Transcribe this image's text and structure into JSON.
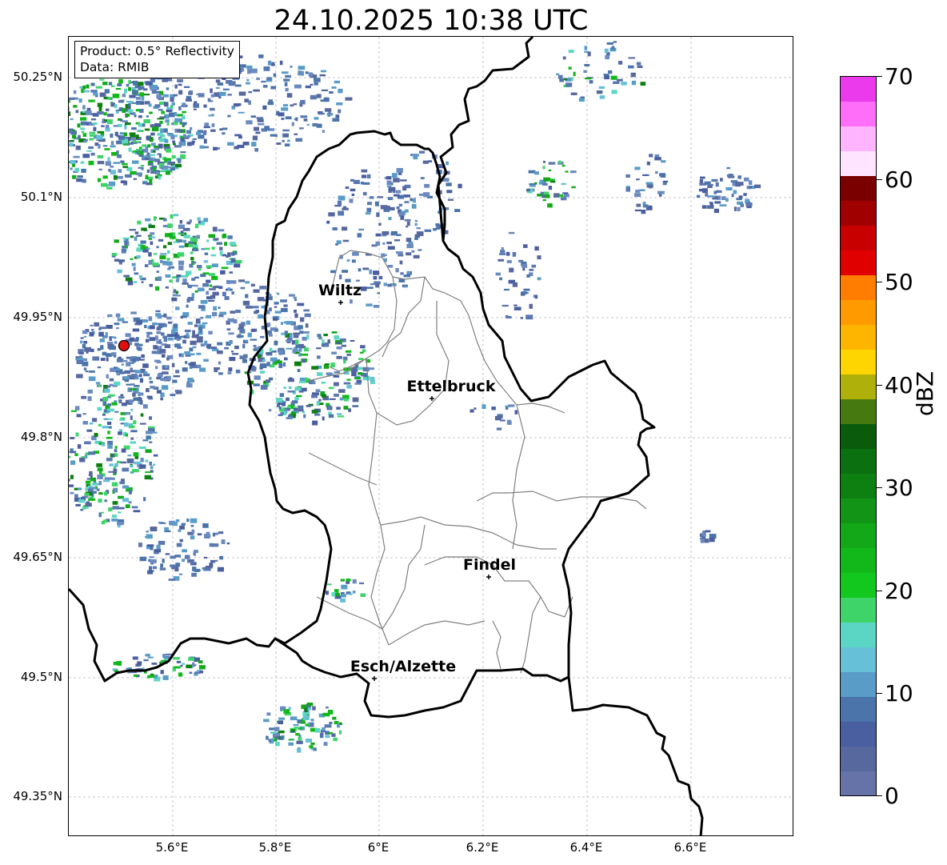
{
  "title": "24.10.2025 10:38 UTC",
  "info_box": {
    "product": "Product: 0.5° Reflectivity",
    "data": "Data: RMIB"
  },
  "axes": {
    "lat_labels": [
      "50.25°N",
      "50.1°N",
      "49.95°N",
      "49.8°N",
      "49.65°N",
      "49.5°N",
      "49.35°N"
    ],
    "lon_labels": [
      "5.6°E",
      "5.8°E",
      "6°E",
      "6.2°E",
      "6.4°E",
      "6.6°E"
    ],
    "gridlines": true
  },
  "cities": [
    {
      "name": "Wiltz"
    },
    {
      "name": "Ettelbruck"
    },
    {
      "name": "Findel"
    },
    {
      "name": "Esch/Alzette"
    }
  ],
  "radar_site": {
    "marker_color": "#e01010"
  },
  "colorbar": {
    "unit": "dBZ",
    "min": 0,
    "max": 70,
    "tick_labels": [
      "70",
      "60",
      "50",
      "40",
      "30",
      "20",
      "10",
      "0"
    ],
    "colors": [
      "#6673a8",
      "#56689e",
      "#4a5fa0",
      "#4a74aa",
      "#5a9cc8",
      "#66c0d8",
      "#5cd6c4",
      "#3fd46a",
      "#12c81e",
      "#12b81a",
      "#12a818",
      "#129416",
      "#0e8012",
      "#0a7010",
      "#0a5c0c",
      "#467a10",
      "#b0b00a",
      "#ffd500",
      "#fdb500",
      "#ff9a00",
      "#ff7d00",
      "#e00000",
      "#c80000",
      "#a00000",
      "#7a0000",
      "#ffe4ff",
      "#ffb4ff",
      "#ff6ef8",
      "#ea3aec"
    ]
  }
}
